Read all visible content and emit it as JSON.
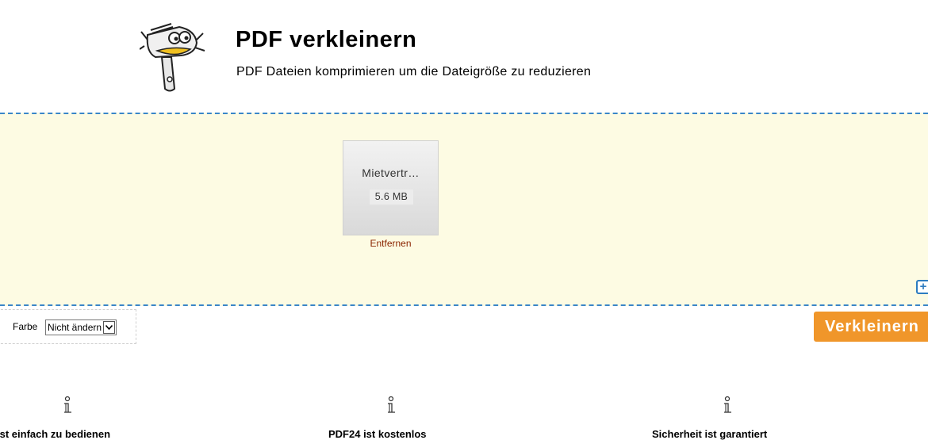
{
  "header": {
    "title": "PDF verkleinern",
    "subtitle": "PDF Dateien komprimieren um die Dateigröße zu reduzieren"
  },
  "dropzone": {
    "files": [
      {
        "name": "Mietvertr…",
        "size": "5.6 MB",
        "remove_label": "Entfernen"
      }
    ],
    "add_icon": "plus-square-icon"
  },
  "options": {
    "color_label": "Farbe",
    "color_value": "Nicht ändern"
  },
  "actions": {
    "compress_label": "Verkleinern"
  },
  "features": [
    {
      "icon": "info-icon",
      "title": "ist einfach zu bedienen"
    },
    {
      "icon": "info-icon",
      "title": "PDF24 ist kostenlos"
    },
    {
      "icon": "info-icon",
      "title": "Sicherheit ist garantiert"
    }
  ],
  "colors": {
    "accent_orange": "#f0962a",
    "dropzone_bg": "#fdfbe3",
    "dropzone_border": "#3a86c8",
    "remove_link": "#8b2500"
  }
}
